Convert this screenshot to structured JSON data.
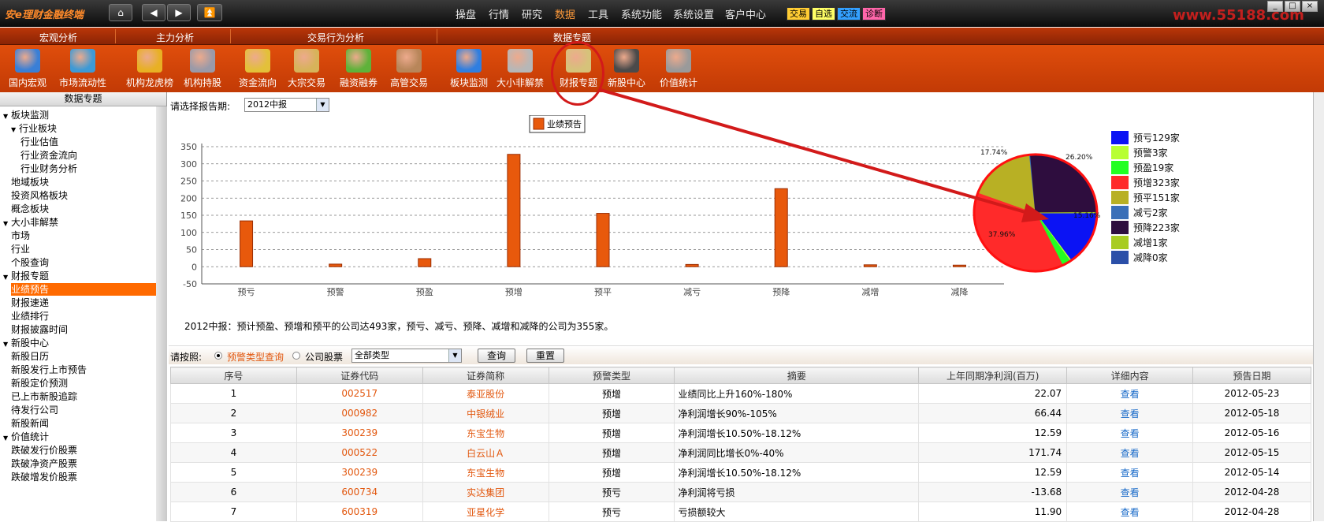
{
  "app": {
    "title": "安e理财金融终端",
    "watermark": "www.55188.com",
    "menu": [
      "操盘",
      "行情",
      "研究",
      "数据",
      "工具",
      "系统功能",
      "系统设置",
      "客户中心"
    ],
    "badges": [
      "交易",
      "自选",
      "交流",
      "诊断"
    ],
    "badge_colors": [
      "#ffcc33",
      "#ffff66",
      "#33a0ff",
      "#ff66aa"
    ]
  },
  "groups": [
    "宏观分析",
    "主力分析",
    "交易行为分析",
    "数据专题"
  ],
  "tools": [
    {
      "label": "国内宏观",
      "icon": "binoculars-icon",
      "color": "#3a7fd6"
    },
    {
      "label": "市场流动性",
      "icon": "globe-chart-icon",
      "color": "#3d9ad6"
    },
    {
      "label": "机构龙虎榜",
      "icon": "medal-icon",
      "color": "#e8b024"
    },
    {
      "label": "机构持股",
      "icon": "bank-icon",
      "color": "#9a9aa8"
    },
    {
      "label": "资金流向",
      "icon": "coin-arrows-icon",
      "color": "#e3c03a"
    },
    {
      "label": "大宗交易",
      "icon": "coin-stacks-icon",
      "color": "#d7b35a"
    },
    {
      "label": "融资融券",
      "icon": "merge-arrow-icon",
      "color": "#5fb23a"
    },
    {
      "label": "高管交易",
      "icon": "ledger-icon",
      "color": "#b8865a"
    },
    {
      "label": "板块监测",
      "icon": "blocks-icon",
      "color": "#2f7ee0"
    },
    {
      "label": "大小非解禁",
      "icon": "padlock-icon",
      "color": "#b7b7b7"
    },
    {
      "label": "财报专题",
      "icon": "report-scroll-icon",
      "color": "#d6c27a"
    },
    {
      "label": "新股中心",
      "icon": "new-stock-icon",
      "color": "#4a4a4a"
    },
    {
      "label": "价值统计",
      "icon": "microphone-icon",
      "color": "#9a9a9a"
    }
  ],
  "sidebar": {
    "title": "数据专题",
    "items": [
      {
        "label": "板块监测",
        "level": 0,
        "tw": "▼"
      },
      {
        "label": "行业板块",
        "level": 1,
        "tw": "▼"
      },
      {
        "label": "行业估值",
        "level": 2,
        "tw": ""
      },
      {
        "label": "行业资金流向",
        "level": 2,
        "tw": ""
      },
      {
        "label": "行业财务分析",
        "level": 2,
        "tw": ""
      },
      {
        "label": "地域板块",
        "level": 1,
        "tw": ""
      },
      {
        "label": "投资风格板块",
        "level": 1,
        "tw": ""
      },
      {
        "label": "概念板块",
        "level": 1,
        "tw": ""
      },
      {
        "label": "大小非解禁",
        "level": 0,
        "tw": "▼"
      },
      {
        "label": "市场",
        "level": 1,
        "tw": ""
      },
      {
        "label": "行业",
        "level": 1,
        "tw": ""
      },
      {
        "label": "个股查询",
        "level": 1,
        "tw": ""
      },
      {
        "label": "财报专题",
        "level": 0,
        "tw": "▼"
      },
      {
        "label": "业绩预告",
        "level": 1,
        "tw": "",
        "selected": true
      },
      {
        "label": "财报速递",
        "level": 1,
        "tw": ""
      },
      {
        "label": "业绩排行",
        "level": 1,
        "tw": ""
      },
      {
        "label": "财报披露时间",
        "level": 1,
        "tw": ""
      },
      {
        "label": "新股中心",
        "level": 0,
        "tw": "▼"
      },
      {
        "label": "新股日历",
        "level": 1,
        "tw": ""
      },
      {
        "label": "新股发行上市预告",
        "level": 1,
        "tw": ""
      },
      {
        "label": "新股定价预测",
        "level": 1,
        "tw": ""
      },
      {
        "label": "已上市新股追踪",
        "level": 1,
        "tw": ""
      },
      {
        "label": "待发行公司",
        "level": 1,
        "tw": ""
      },
      {
        "label": "新股新闻",
        "level": 1,
        "tw": ""
      },
      {
        "label": "价值统计",
        "level": 0,
        "tw": "▼"
      },
      {
        "label": "跌破发行价股票",
        "level": 1,
        "tw": ""
      },
      {
        "label": "跌破净资产股票",
        "level": 1,
        "tw": ""
      },
      {
        "label": "跌破增发价股票",
        "level": 1,
        "tw": ""
      }
    ]
  },
  "report": {
    "period_label": "请选择报告期:",
    "period_value": "2012中报",
    "note": "2012中报：预计预盈、预增和预平的公司达493家，预亏、减亏、预降、减增和减降的公司为355家。",
    "query_label": "请按照:",
    "radio1": "预警类型查询",
    "radio2": "公司股票",
    "type_value": "全部类型",
    "query_btn": "查询",
    "reset_btn": "重置"
  },
  "chart_data": {
    "type": "bar",
    "legend": "业绩预告",
    "categories": [
      "预亏",
      "预警",
      "预盈",
      "预增",
      "预平",
      "减亏",
      "预降",
      "减增",
      "减降"
    ],
    "values": [
      129,
      3,
      19,
      323,
      151,
      2,
      223,
      1,
      0
    ],
    "yticks": [
      350,
      300,
      250,
      200,
      150,
      100,
      50,
      0,
      -50
    ],
    "ylim": [
      -50,
      350
    ],
    "grid": true,
    "pie": {
      "type": "pie",
      "labels": [
        "预亏129家",
        "预警3家",
        "预盈19家",
        "预增323家",
        "预平151家",
        "减亏2家",
        "预降223家",
        "减增1家",
        "减降0家"
      ],
      "values": [
        129,
        3,
        19,
        323,
        151,
        2,
        223,
        1,
        0
      ],
      "colors": [
        "#0b13f4",
        "#b8ff33",
        "#22ff22",
        "#ff2a2a",
        "#b8b024",
        "#3a6fb8",
        "#2e0d3e",
        "#a8cc22",
        "#2b4fa8"
      ],
      "slice_labels": [
        "15.16%",
        "37.96%",
        "17.74%",
        "26.20%"
      ]
    }
  },
  "table": {
    "columns": [
      "序号",
      "证券代码",
      "证券简称",
      "预警类型",
      "摘要",
      "上年同期净利润(百万)",
      "详细内容",
      "预告日期"
    ],
    "rows": [
      [
        "1",
        "002517",
        "泰亚股份",
        "预增",
        "业绩同比上升160%-180%",
        "22.07",
        "查看",
        "2012-05-23"
      ],
      [
        "2",
        "000982",
        "中银绒业",
        "预增",
        "净利润增长90%-105%",
        "66.44",
        "查看",
        "2012-05-18"
      ],
      [
        "3",
        "300239",
        "东宝生物",
        "预增",
        "净利润增长10.50%-18.12%",
        "12.59",
        "查看",
        "2012-05-16"
      ],
      [
        "4",
        "000522",
        "白云山Ａ",
        "预增",
        "净利润同比增长0%-40%",
        "171.74",
        "查看",
        "2012-05-15"
      ],
      [
        "5",
        "300239",
        "东宝生物",
        "预增",
        "净利润增长10.50%-18.12%",
        "12.59",
        "查看",
        "2012-05-14"
      ],
      [
        "6",
        "600734",
        "实达集团",
        "预亏",
        "净利润将亏损",
        "-13.68",
        "查看",
        "2012-04-28"
      ],
      [
        "7",
        "600319",
        "亚星化学",
        "预亏",
        "亏损额较大",
        "11.90",
        "查看",
        "2012-04-28"
      ]
    ]
  }
}
